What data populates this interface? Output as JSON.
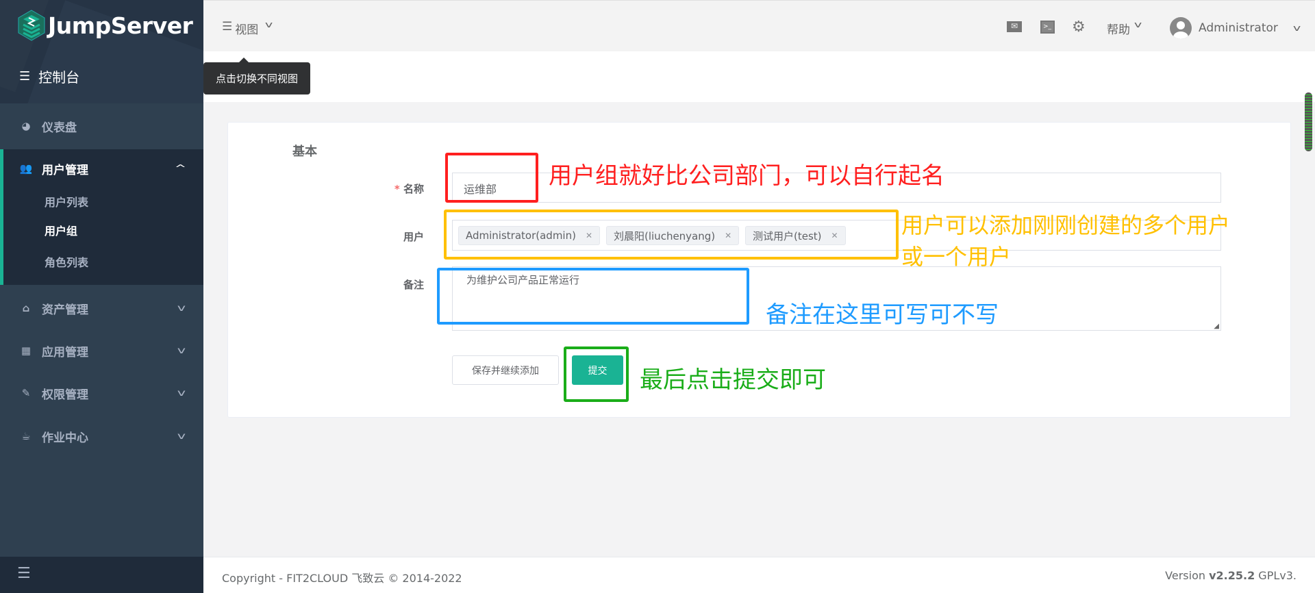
{
  "brand": {
    "name": "JumpServer"
  },
  "sidebar": {
    "console": "控制台",
    "items": [
      {
        "label": "仪表盘",
        "icon": "dashboard-icon"
      },
      {
        "label": "用户管理",
        "icon": "users-icon",
        "expanded": true,
        "children": [
          {
            "label": "用户列表"
          },
          {
            "label": "用户组",
            "active": true
          },
          {
            "label": "角色列表"
          }
        ]
      },
      {
        "label": "资产管理",
        "icon": "inbox-icon"
      },
      {
        "label": "应用管理",
        "icon": "grid-icon"
      },
      {
        "label": "权限管理",
        "icon": "edit-icon"
      },
      {
        "label": "作业中心",
        "icon": "coffee-icon"
      }
    ]
  },
  "header": {
    "view": "视图",
    "tooltip": "点击切换不同视图",
    "help": "帮助",
    "user": "Administrator"
  },
  "form": {
    "section": "基本",
    "name_label": "名称",
    "name_value": "运维部",
    "users_label": "用户",
    "users": [
      "Administrator(admin)",
      "刘晨阳(liuchenyang)",
      "测试用户(test)"
    ],
    "remark_label": "备注",
    "remark_value": "为维护公司产品正常运行",
    "save_continue": "保存并继续添加",
    "submit": "提交"
  },
  "annotations": {
    "name": "用户组就好比公司部门，可以自行起名",
    "users_line1": "用户可以添加刚刚创建的多个用户",
    "users_line2": "或一个用户",
    "remark": "备注在这里可写可不写",
    "submit": "最后点击提交即可",
    "colors": {
      "red": "#ff1f1f",
      "yellow": "#ffc000",
      "blue": "#1e9bff",
      "green": "#1aad19"
    }
  },
  "footer": {
    "copyright": "Copyright - FIT2CLOUD 飞致云 © 2014-2022",
    "version_prefix": "Version ",
    "version": "v2.25.2",
    "license": " GPLv3."
  },
  "colors": {
    "accent": "#1ab394",
    "sidebar": "#2f4050"
  }
}
